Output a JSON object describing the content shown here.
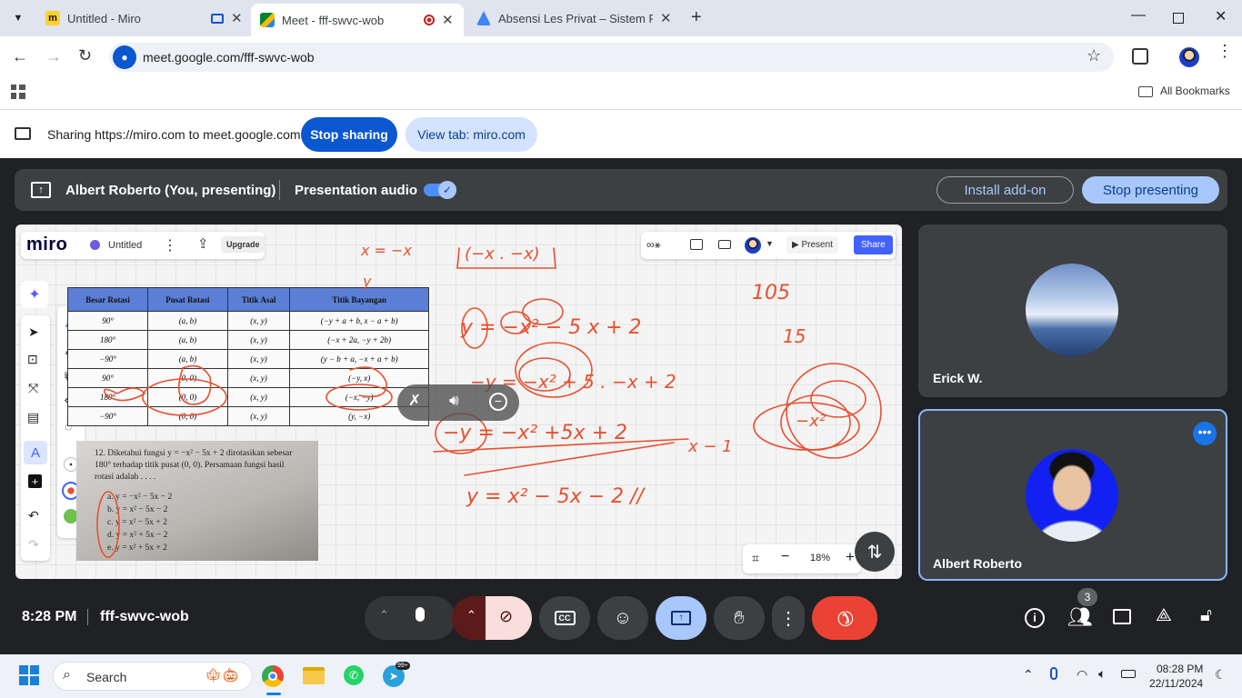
{
  "browser": {
    "tabs": [
      {
        "title": "Untitled - Miro",
        "active": false
      },
      {
        "title": "Meet - fff-swvc-wob",
        "active": true
      },
      {
        "title": "Absensi Les Privat – Sistem Rua",
        "active": false
      }
    ],
    "url": "meet.google.com/fff-swvc-wob",
    "bookmarks_label": "All Bookmarks"
  },
  "sharing": {
    "text": "Sharing https://miro.com to meet.google.com",
    "stop_label": "Stop sharing",
    "view_label": "View tab: miro.com"
  },
  "present_bar": {
    "presenter": "Albert Roberto (You, presenting)",
    "audio_label": "Presentation audio",
    "audio_on": true,
    "install_label": "Install add-on",
    "stop_label": "Stop presenting"
  },
  "miro": {
    "logo": "miro",
    "board_name": "Untitled",
    "upgrade_label": "Upgrade",
    "present_label": "Present",
    "share_label": "Share",
    "zoom": "18%",
    "table": {
      "headers": [
        "Besar Rotasi",
        "Pusat Rotasi",
        "Titik Asal",
        "Titik Bayangan"
      ],
      "rows": [
        [
          "90°",
          "(a, b)",
          "(x, y)",
          "(−y + a + b, x − a + b)"
        ],
        [
          "180°",
          "(a, b)",
          "(x, y)",
          "(−x + 2a, −y + 2b)"
        ],
        [
          "−90°",
          "(a, b)",
          "(x, y)",
          "(y − b + a, −x + a + b)"
        ],
        [
          "90°",
          "(0, 0)",
          "(x, y)",
          "(−y, x)"
        ],
        [
          "180°",
          "(0, 0)",
          "(x, y)",
          "(−x, −y)"
        ],
        [
          "−90°",
          "(0, 0)",
          "(x, y)",
          "(y, −x)"
        ]
      ]
    },
    "question": {
      "stem": "12. Diketahui fungsi y = −x² − 5x + 2 dirotasikan sebesar 180° terhadap titik pusat (0, 0). Persamaan fungsi hasil rotasi adalah . . . .",
      "options": [
        "a. y = −x² − 5x − 2",
        "b. y = x² − 5x − 2",
        "c. y = x² − 5x + 2",
        "d. y = x² + 5x − 2",
        "e. y = x² + 5x + 2"
      ]
    },
    "handwriting": [
      "x = −x",
      "(−x . −x)",
      "y",
      "105",
      "15",
      "y = −x² − 5 x + 2",
      "−y = −x² + 5 . −x + 2",
      "−y = −x² +5x + 2",
      "x − 1",
      "y = x² − 5x − 2 //",
      "−x²"
    ]
  },
  "participants": [
    {
      "name": "Erick W."
    },
    {
      "name": "Albert Roberto"
    }
  ],
  "bottom": {
    "time": "8:28 PM",
    "meeting_code": "fff-swvc-wob",
    "people_count": "3"
  },
  "taskbar": {
    "search_placeholder": "Search",
    "telegram_badge": "99+",
    "clock_time": "08:28 PM",
    "clock_date": "22/11/2024"
  },
  "colors": {
    "accent": "#0b57d0",
    "pen_red": "#e8502e",
    "end_call": "#ea4335",
    "table_header": "#5b7fd6"
  }
}
